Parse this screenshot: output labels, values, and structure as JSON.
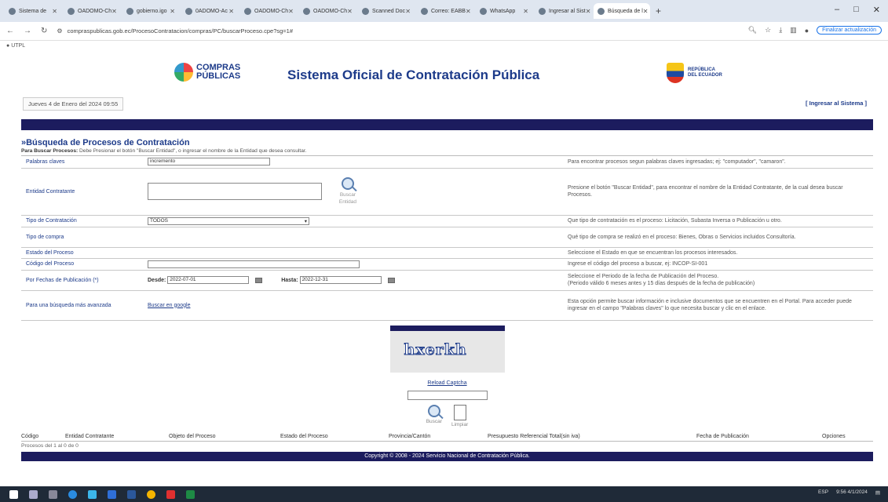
{
  "browser": {
    "tabs": [
      {
        "label": "Sistema de",
        "active": false
      },
      {
        "label": "OADOMO-Ch",
        "active": false
      },
      {
        "label": "gobierno.igo",
        "active": false
      },
      {
        "label": "0ADOMO-Ac",
        "active": false
      },
      {
        "label": "OADOMO-Ch",
        "active": false
      },
      {
        "label": "OADOMO-Ch",
        "active": false
      },
      {
        "label": "Scanned Doc",
        "active": false
      },
      {
        "label": "Correo: EABB",
        "active": false
      },
      {
        "label": "WhatsApp",
        "active": false
      },
      {
        "label": "Ingresar al Sist",
        "active": false
      },
      {
        "label": "Búsqueda de l",
        "active": true
      }
    ],
    "url": "compraspublicas.gob.ec/ProcesoContratacion/compras/PC/buscarProceso.cpe?sg=1#",
    "update_label": "Finalizar actualización",
    "bookmark": "UTPL"
  },
  "header": {
    "logo_text_1": "COMPRAS",
    "logo_text_2": "PÚBLICAS",
    "title": "Sistema Oficial de Contratación Pública",
    "ecuador_1": "REPÚBLICA",
    "ecuador_2": "DEL ECUADOR",
    "date": "Jueves 4 de Enero del 2024 09:55",
    "login": "[ Ingresar al Sistema ]"
  },
  "search": {
    "title": "»Búsqueda de Procesos de Contratación",
    "intro_bold": "Para Buscar Procesos:",
    "intro_text": " Debe Presionar el botón \"Buscar Entidad\", o ingresar el nombre de la Entidad que desea consultar.",
    "rows": {
      "keywords": {
        "label": "Palabras claves",
        "value": "incremento",
        "help": "Para encontrar procesos segun palabras claves ingresadas; ej: \"computador\", \"camaron\"."
      },
      "entity": {
        "label": "Entidad Contratante",
        "button": "Buscar Entidad",
        "help": "Presione el botón \"Buscar Entidad\", para encontrar el nombre de la Entidad Contratante, de la cual desea buscar Procesos."
      },
      "type": {
        "label": "Tipo de Contratación",
        "value": "TODOS",
        "help": "Que tipo de contratación es el proceso: Licitación, Subasta Inversa o Publicación u otro."
      },
      "purchase": {
        "label": "Tipo de compra",
        "help": "Qué tipo de compra se realizó en el proceso: Bienes, Obras o Servicios incluidos Consultoría."
      },
      "status": {
        "label": "Estado del Proceso",
        "help": "Seleccione el Estado en que se encuentran los procesos interesados."
      },
      "code": {
        "label": "Código del Proceso",
        "help": "Ingrese el código del proceso a buscar, ej: INCOP-SI-001"
      },
      "dates": {
        "label": "Por Fechas de Publicación",
        "label_star": " (*)",
        "from_label": "Desde:",
        "from_value": "2022-07-01",
        "to_label": "Hasta:",
        "to_value": "2022-12-31",
        "help_1": "Seleccione el Periodo de la fecha de Publicación del Proceso.",
        "help_2": "(Periodo válido 6 meses antes y 15 días después de la fecha de publicación)"
      },
      "advanced": {
        "label": "Para una búsqueda más avanzada",
        "link": "Buscar en google",
        "help": "Esta opción permite buscar información e inclusive documentos que se encuentren en el Portal. Para acceder puede ingresar en el campo \"Palabras claves\" lo que necesita buscar y clic en el enlace."
      }
    },
    "captcha_text": "hxerkh",
    "reload": "Reload Captcha",
    "btn_search": "Buscar",
    "btn_clear": "Limpiar"
  },
  "results": {
    "columns": [
      "Código",
      "Entidad Contratante",
      "Objeto del Proceso",
      "Estado del Proceso",
      "Provincia/Cantón",
      "Presupuesto Referencial Total(sin iva)",
      "Fecha de Publicación",
      "Opciones"
    ],
    "count": "Procesos del 1 al 0 de 0"
  },
  "footer": "Copyright © 2008 - 2024 Servicio Nacional de Contratación Pública.",
  "taskbar": {
    "time": "9:56",
    "date": "4/1/2024",
    "lang": "ESP"
  }
}
